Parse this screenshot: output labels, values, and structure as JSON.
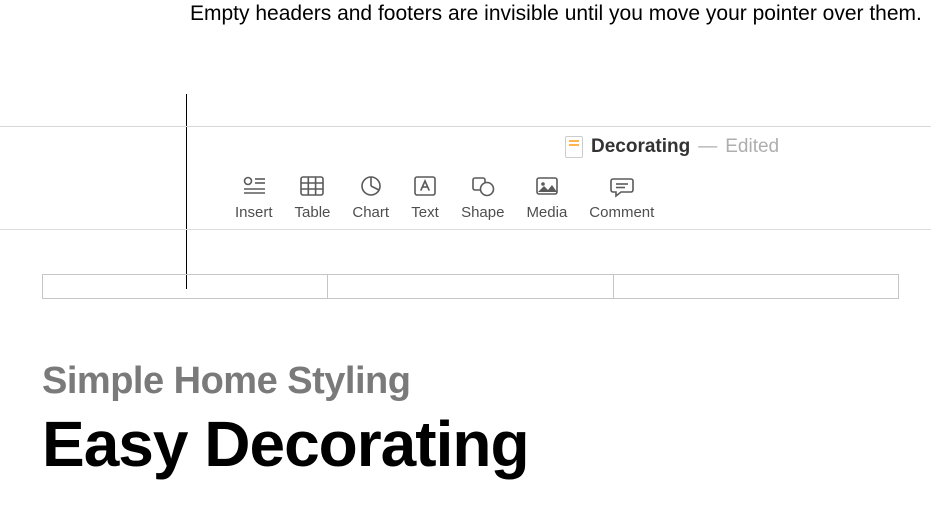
{
  "callout": {
    "text": "Empty headers and footers are invisible until you move your pointer over them."
  },
  "titlebar": {
    "doc_name": "Decorating",
    "dash": "—",
    "status": "Edited"
  },
  "toolbar": {
    "insert": "Insert",
    "table": "Table",
    "chart": "Chart",
    "text": "Text",
    "shape": "Shape",
    "media": "Media",
    "comment": "Comment"
  },
  "document": {
    "subtitle": "Simple Home Styling",
    "title": "Easy Decorating"
  }
}
